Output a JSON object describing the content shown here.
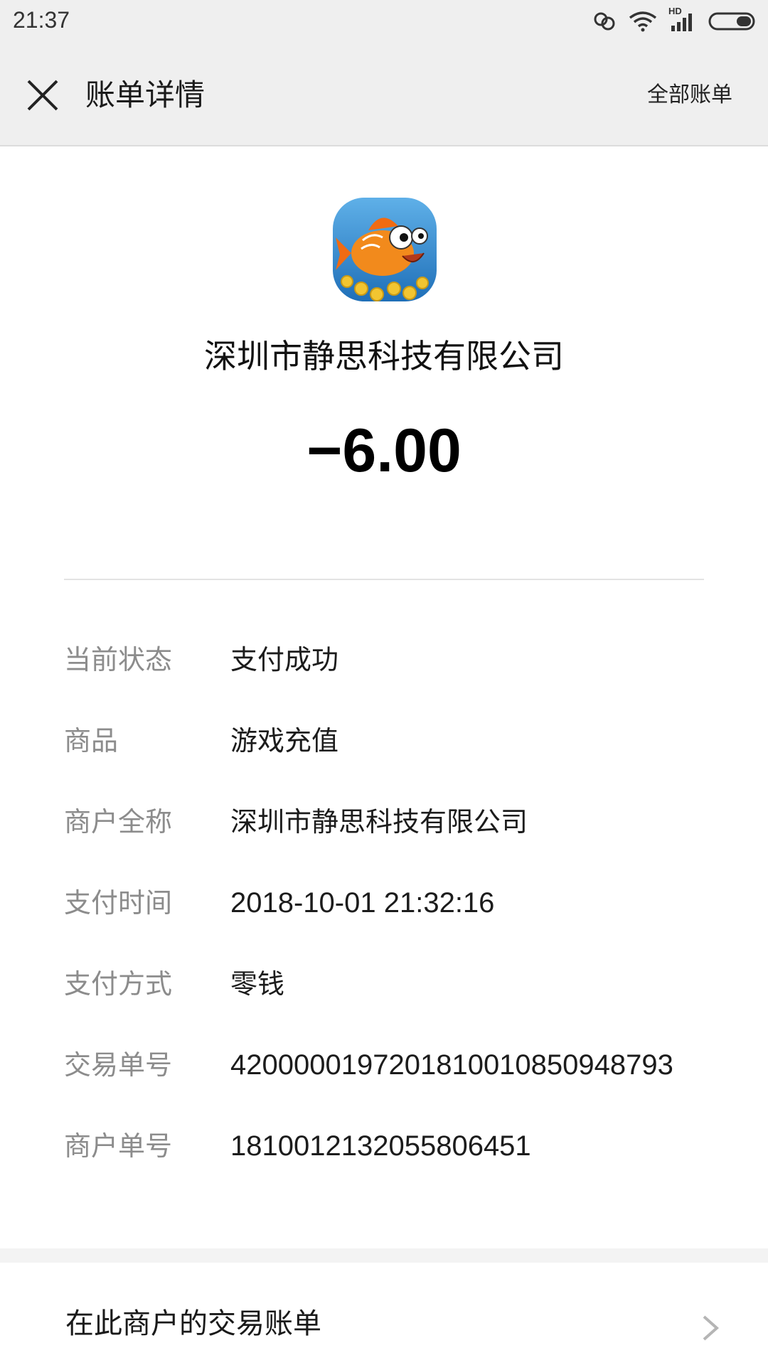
{
  "status_bar": {
    "time": "21:37",
    "network_label": "HD",
    "icons": [
      "loop-icon",
      "wifi-icon",
      "signal-icon",
      "battery-icon"
    ]
  },
  "nav": {
    "title": "账单详情",
    "right_link": "全部账单",
    "close_icon": "close-icon"
  },
  "merchant": {
    "name": "深圳市静思科技有限公司",
    "amount": "−6.00",
    "logo": "fish-game-logo"
  },
  "details": [
    {
      "label": "当前状态",
      "value": "支付成功"
    },
    {
      "label": "商品",
      "value": "游戏充值"
    },
    {
      "label": "商户全称",
      "value": "深圳市静思科技有限公司"
    },
    {
      "label": "支付时间",
      "value": "2018-10-01 21:32:16"
    },
    {
      "label": "支付方式",
      "value": "零钱"
    },
    {
      "label": "交易单号",
      "value": "4200000197201810010850948793"
    },
    {
      "label": "商户单号",
      "value": "1810012132055806451"
    }
  ],
  "bottom": {
    "link_label": "在此商户的交易账单",
    "chevron_icon": "chevron-right-icon"
  },
  "colors": {
    "header_bg": "#efefef",
    "label_text": "#8c8c8c",
    "value_text": "#1c1c1c"
  }
}
